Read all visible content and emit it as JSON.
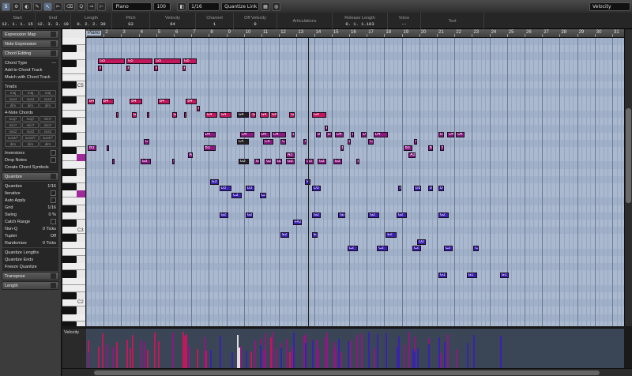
{
  "toolbar": {
    "buttons": [
      "S",
      "⚙",
      "◐",
      "✎",
      "↖",
      "✂",
      "⌫",
      "Q",
      "⊸",
      "⊢"
    ],
    "instrument": "Piano",
    "value100": "100",
    "grid": "1/16",
    "quantize_link": "Quantize Link",
    "lane_param": "Velocity"
  },
  "info": {
    "columns": [
      {
        "h": "Start",
        "v": "12. 1. 1. 15"
      },
      {
        "h": "End",
        "v": "12. 3. 3. 19"
      },
      {
        "h": "Length",
        "v": "0. 2. 2. 30"
      },
      {
        "h": "Pitch",
        "v": "G3"
      },
      {
        "h": "Velocity",
        "v": "64"
      },
      {
        "h": "Channel",
        "v": "1"
      },
      {
        "h": "Off Velocity",
        "v": "0"
      },
      {
        "h": "Articulations",
        "v": ""
      },
      {
        "h": "Release Length",
        "v": "0. 1. 1.103"
      },
      {
        "h": "Voice",
        "v": "--"
      },
      {
        "h": "Text",
        "v": ""
      }
    ]
  },
  "inspector": {
    "expression_map": "Expression Map",
    "note_expression": "Note Expression",
    "chord_editing": "Chord Editing",
    "chord_type": "Chord Type",
    "chord_type_value": "---",
    "add_chord_track": "Add to Chord Track",
    "match_chord_track": "Match with Chord Track",
    "triads": "Triads",
    "triad_buttons": [
      "maj",
      "maj",
      "maj",
      "sus4",
      "sus4",
      "sus4",
      "dim",
      "dim",
      "dim"
    ],
    "four_note": "4-Note Chords",
    "four_note_buttons": [
      "maj7",
      "maj7",
      "min7",
      "min7",
      "min7",
      "min7",
      "sus2",
      "sus2",
      "sus2",
      "sus4/7",
      "sus4/7",
      "sus4/7",
      "dim",
      "dim",
      "dim"
    ],
    "inversions": "Inversions",
    "drop_notes": "Drop Notes",
    "create_chord_symbols": "Create Chord Symbols",
    "quantize": "Quantize",
    "quantize_value": "1/16",
    "iterative": "Iterative",
    "auto_apply": "Auto Apply",
    "grid_label": "Grid",
    "grid_value": "1/16",
    "swing_label": "Swing",
    "swing_value": "0 %",
    "catch_label": "Catch Range",
    "nonq_label": "Non-Q",
    "nonq_value": "0 Ticks",
    "tuplet_label": "Tuplet",
    "tuplet_value": "Off",
    "randomize_label": "Randomize",
    "randomize_value": "0 Ticks",
    "quantize_lengths": "Quantize Lengths",
    "quantize_ends": "Quantize Ends",
    "freeze_quantize": "Freeze Quantize",
    "transpose": "Transpose",
    "length": "Length"
  },
  "keyboard": {
    "octaves": [
      "C5",
      "C4",
      "C3",
      "C2"
    ]
  },
  "ruler": {
    "bars": [
      "1",
      "2",
      "3",
      "4",
      "5",
      "6",
      "7",
      "8",
      "9",
      "10",
      "11",
      "12",
      "13",
      "14",
      "15",
      "16",
      "17",
      "18",
      "19",
      "20",
      "21",
      "22",
      "23",
      "24",
      "25",
      "26",
      "27",
      "28",
      "29",
      "30",
      "31"
    ],
    "part_label": "Piano"
  },
  "velocity_lane_label": "Velocity",
  "colors": {
    "note_hi": "#c0185a",
    "note_mid": "#8a1a80",
    "note_lo": "#3a22b0",
    "selected": "#222222",
    "grid_bg": "#aab9cf"
  },
  "notes": [
    {
      "p": "G5",
      "s": 0.6,
      "l": 1.5,
      "r": 3
    },
    {
      "p": "G5",
      "s": 2.2,
      "l": 1.5,
      "r": 3
    },
    {
      "p": "G5",
      "s": 3.8,
      "l": 1.5,
      "r": 3
    },
    {
      "p": "G5",
      "s": 5.4,
      "l": 0.8,
      "r": 3
    },
    {
      "p": "F5",
      "s": 0.6,
      "l": 0.2,
      "r": 4
    },
    {
      "p": "F5",
      "s": 2.2,
      "l": 0.2,
      "r": 4
    },
    {
      "p": "F5",
      "s": 3.8,
      "l": 0.2,
      "r": 4
    },
    {
      "p": "F5",
      "s": 5.4,
      "l": 0.2,
      "r": 4
    },
    {
      "p": "B4",
      "s": 0.0,
      "l": 0.4,
      "r": 9
    },
    {
      "p": "B4",
      "s": 0.8,
      "l": 0.7,
      "r": 9
    },
    {
      "p": "B4",
      "s": 2.4,
      "l": 0.7,
      "r": 9
    },
    {
      "p": "B4",
      "s": 4.0,
      "l": 0.7,
      "r": 9
    },
    {
      "p": "B4",
      "s": 5.6,
      "l": 0.6,
      "r": 9
    },
    {
      "p": "A4",
      "s": 6.2,
      "l": 0.2,
      "r": 10
    },
    {
      "p": "G4",
      "s": 1.6,
      "l": 0.1,
      "r": 11
    },
    {
      "p": "G4",
      "s": 2.5,
      "l": 0.3,
      "r": 11
    },
    {
      "p": "G4",
      "s": 3.4,
      "l": 0.1,
      "r": 11
    },
    {
      "p": "G4",
      "s": 4.8,
      "l": 0.3,
      "r": 11
    },
    {
      "p": "G4",
      "s": 5.5,
      "l": 0.1,
      "r": 11
    },
    {
      "p": "G4",
      "s": 6.7,
      "l": 0.7,
      "r": 11
    },
    {
      "p": "G4",
      "s": 7.5,
      "l": 0.7,
      "r": 11
    },
    {
      "p": "G4",
      "s": 8.5,
      "l": 0.7,
      "r": 11,
      "sel": true
    },
    {
      "p": "G4",
      "s": 9.3,
      "l": 0.3,
      "r": 11
    },
    {
      "p": "G4",
      "s": 9.8,
      "l": 0.5,
      "r": 11
    },
    {
      "p": "G4",
      "s": 10.4,
      "l": 0.4,
      "r": 11
    },
    {
      "p": "G4",
      "s": 11.5,
      "l": 0.3,
      "r": 11
    },
    {
      "p": "G4",
      "s": 12.8,
      "l": 0.8,
      "r": 11
    },
    {
      "p": "E4",
      "s": 13.5,
      "l": 0.2,
      "r": 13
    },
    {
      "p": "D4",
      "s": 6.6,
      "l": 0.7,
      "r": 14
    },
    {
      "p": "D4",
      "s": 8.7,
      "l": 0.8,
      "r": 14
    },
    {
      "p": "D4",
      "s": 9.8,
      "l": 0.6,
      "r": 14
    },
    {
      "p": "D4",
      "s": 10.5,
      "l": 0.8,
      "r": 14
    },
    {
      "p": "D4",
      "s": 11.6,
      "l": 0.2,
      "r": 14
    },
    {
      "p": "D4",
      "s": 13.0,
      "l": 0.3,
      "r": 14
    },
    {
      "p": "D4",
      "s": 13.6,
      "l": 0.3,
      "r": 14
    },
    {
      "p": "D4",
      "s": 14.1,
      "l": 0.5,
      "r": 14
    },
    {
      "p": "D4",
      "s": 15.0,
      "l": 0.2,
      "r": 14
    },
    {
      "p": "D4",
      "s": 15.6,
      "l": 0.3,
      "r": 14
    },
    {
      "p": "D4",
      "s": 16.3,
      "l": 0.8,
      "r": 14
    },
    {
      "p": "D4",
      "s": 20.0,
      "l": 0.3,
      "r": 14
    },
    {
      "p": "D4",
      "s": 20.5,
      "l": 0.4,
      "r": 14
    },
    {
      "p": "D4",
      "s": 21.0,
      "l": 0.5,
      "r": 14
    },
    {
      "p": "C4",
      "s": 3.2,
      "l": 0.3,
      "r": 15
    },
    {
      "p": "C4",
      "s": 8.5,
      "l": 0.7,
      "r": 15,
      "sel": true
    },
    {
      "p": "C4",
      "s": 10.0,
      "l": 0.6,
      "r": 15
    },
    {
      "p": "C4",
      "s": 11.0,
      "l": 0.3,
      "r": 15
    },
    {
      "p": "C4",
      "s": 12.3,
      "l": 0.2,
      "r": 15
    },
    {
      "p": "C4",
      "s": 14.8,
      "l": 0.2,
      "r": 15
    },
    {
      "p": "C4",
      "s": 16.0,
      "l": 0.3,
      "r": 15
    },
    {
      "p": "C4",
      "s": 18.6,
      "l": 0.2,
      "r": 15
    },
    {
      "p": "B3",
      "s": 0.0,
      "l": 0.5,
      "r": 16
    },
    {
      "p": "B3",
      "s": 1.1,
      "l": 0.1,
      "r": 16
    },
    {
      "p": "B3",
      "s": 6.6,
      "l": 0.7,
      "r": 16
    },
    {
      "p": "B3",
      "s": 14.4,
      "l": 0.2,
      "r": 16
    },
    {
      "p": "B3",
      "s": 18.0,
      "l": 0.5,
      "r": 16
    },
    {
      "p": "B3",
      "s": 19.4,
      "l": 0.3,
      "r": 16
    },
    {
      "p": "B3",
      "s": 20.1,
      "l": 0.2,
      "r": 16
    },
    {
      "p": "A3",
      "s": 5.7,
      "l": 0.3,
      "r": 17
    },
    {
      "p": "A3",
      "s": 11.3,
      "l": 0.5,
      "r": 17
    },
    {
      "p": "A3",
      "s": 18.3,
      "l": 0.4,
      "r": 17
    },
    {
      "p": "G3",
      "s": 1.4,
      "l": 0.1,
      "r": 18
    },
    {
      "p": "G3",
      "s": 3.0,
      "l": 0.6,
      "r": 18
    },
    {
      "p": "G3",
      "s": 4.8,
      "l": 0.1,
      "r": 18
    },
    {
      "p": "G3",
      "s": 8.6,
      "l": 0.6,
      "r": 18,
      "sel": true
    },
    {
      "p": "G3",
      "s": 9.5,
      "l": 0.3,
      "r": 18
    },
    {
      "p": "G3",
      "s": 10.1,
      "l": 0.4,
      "r": 18
    },
    {
      "p": "G3",
      "s": 10.7,
      "l": 0.4,
      "r": 18
    },
    {
      "p": "G3",
      "s": 11.3,
      "l": 0.5,
      "r": 18
    },
    {
      "p": "G3",
      "s": 12.4,
      "l": 0.5,
      "r": 18
    },
    {
      "p": "G3",
      "s": 13.1,
      "l": 0.5,
      "r": 18
    },
    {
      "p": "G3",
      "s": 14.0,
      "l": 0.5,
      "r": 18
    },
    {
      "p": "G3",
      "s": 15.3,
      "l": 0.2,
      "r": 18
    },
    {
      "p": "E3",
      "s": 7.0,
      "l": 0.5,
      "r": 21
    },
    {
      "p": "E3",
      "s": 12.4,
      "l": 0.3,
      "r": 21
    },
    {
      "p": "D3",
      "s": 7.5,
      "l": 0.7,
      "r": 22
    },
    {
      "p": "D3",
      "s": 9.0,
      "l": 0.5,
      "r": 22
    },
    {
      "p": "D3",
      "s": 12.8,
      "l": 0.5,
      "r": 22
    },
    {
      "p": "D3",
      "s": 17.7,
      "l": 0.2,
      "r": 22
    },
    {
      "p": "D3",
      "s": 18.6,
      "l": 0.4,
      "r": 22
    },
    {
      "p": "D3",
      "s": 19.4,
      "l": 0.3,
      "r": 22
    },
    {
      "p": "D3",
      "s": 20.0,
      "l": 0.3,
      "r": 22
    },
    {
      "p": "C3",
      "s": 8.2,
      "l": 0.6,
      "r": 23
    },
    {
      "p": "C3",
      "s": 9.8,
      "l": 0.4,
      "r": 23
    },
    {
      "p": "G2",
      "s": 7.5,
      "l": 0.5,
      "r": 26
    },
    {
      "p": "G2",
      "s": 9.0,
      "l": 0.4,
      "r": 26
    },
    {
      "p": "G2",
      "s": 12.8,
      "l": 0.5,
      "r": 26
    },
    {
      "p": "G2",
      "s": 14.3,
      "l": 0.4,
      "r": 26
    },
    {
      "p": "G2",
      "s": 16.0,
      "l": 0.6,
      "r": 26
    },
    {
      "p": "G2",
      "s": 17.6,
      "l": 0.6,
      "r": 26
    },
    {
      "p": "G2",
      "s": 20.0,
      "l": 0.6,
      "r": 26
    },
    {
      "p": "F#2",
      "s": 11.7,
      "l": 0.5,
      "r": 27
    },
    {
      "p": "E2",
      "s": 11.0,
      "l": 0.5,
      "r": 29
    },
    {
      "p": "E2",
      "s": 12.8,
      "l": 0.3,
      "r": 29
    },
    {
      "p": "E2",
      "s": 17.0,
      "l": 0.6,
      "r": 29
    },
    {
      "p": "D2",
      "s": 18.8,
      "l": 0.5,
      "r": 30
    },
    {
      "p": "C2",
      "s": 14.8,
      "l": 0.6,
      "r": 31
    },
    {
      "p": "C2",
      "s": 16.5,
      "l": 0.6,
      "r": 31
    },
    {
      "p": "C2",
      "s": 18.5,
      "l": 0.5,
      "r": 31
    },
    {
      "p": "C2",
      "s": 20.3,
      "l": 0.5,
      "r": 31
    },
    {
      "p": "C2",
      "s": 22.0,
      "l": 0.3,
      "r": 31
    },
    {
      "p": "G1",
      "s": 20.0,
      "l": 0.5,
      "r": 35
    },
    {
      "p": "G1",
      "s": 21.6,
      "l": 0.6,
      "r": 35
    },
    {
      "p": "G1",
      "s": 23.5,
      "l": 0.5,
      "r": 35
    }
  ]
}
